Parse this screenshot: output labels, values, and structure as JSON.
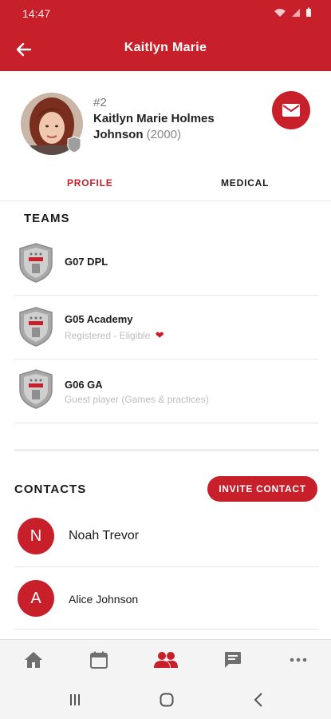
{
  "status_bar": {
    "time": "14:47"
  },
  "header": {
    "title": "Kaitlyn Marie"
  },
  "profile": {
    "jersey": "#2",
    "name_line1": "Kaitlyn Marie Holmes",
    "name_line2": "Johnson",
    "birth_year": "(2000)"
  },
  "tabs": [
    {
      "label": "PROFILE",
      "active": true
    },
    {
      "label": "MEDICAL",
      "active": false
    }
  ],
  "teams": {
    "title": "TEAMS",
    "items": [
      {
        "name": "G07 DPL",
        "subtitle": ""
      },
      {
        "name": "G05 Academy",
        "subtitle": "Registered - Eligible",
        "medical_icon": "heart-icon"
      },
      {
        "name": "G06 GA",
        "subtitle": "Guest player (Games & practices)"
      }
    ]
  },
  "contacts": {
    "title": "CONTACTS",
    "invite_label": "INVITE CONTACT",
    "items": [
      {
        "initial": "N",
        "name": "Noah Trevor"
      },
      {
        "initial": "A",
        "name": "Alice Johnson"
      }
    ]
  },
  "bottom_nav": [
    {
      "icon": "home-icon",
      "active": false
    },
    {
      "icon": "calendar-icon",
      "active": false
    },
    {
      "icon": "people-icon",
      "active": true
    },
    {
      "icon": "chat-icon",
      "active": false
    },
    {
      "icon": "more-icon",
      "active": false
    }
  ],
  "colors": {
    "brand": "#c8202b",
    "inactive_icon": "#6f6f6f",
    "subtitle": "#bdbdbd"
  }
}
